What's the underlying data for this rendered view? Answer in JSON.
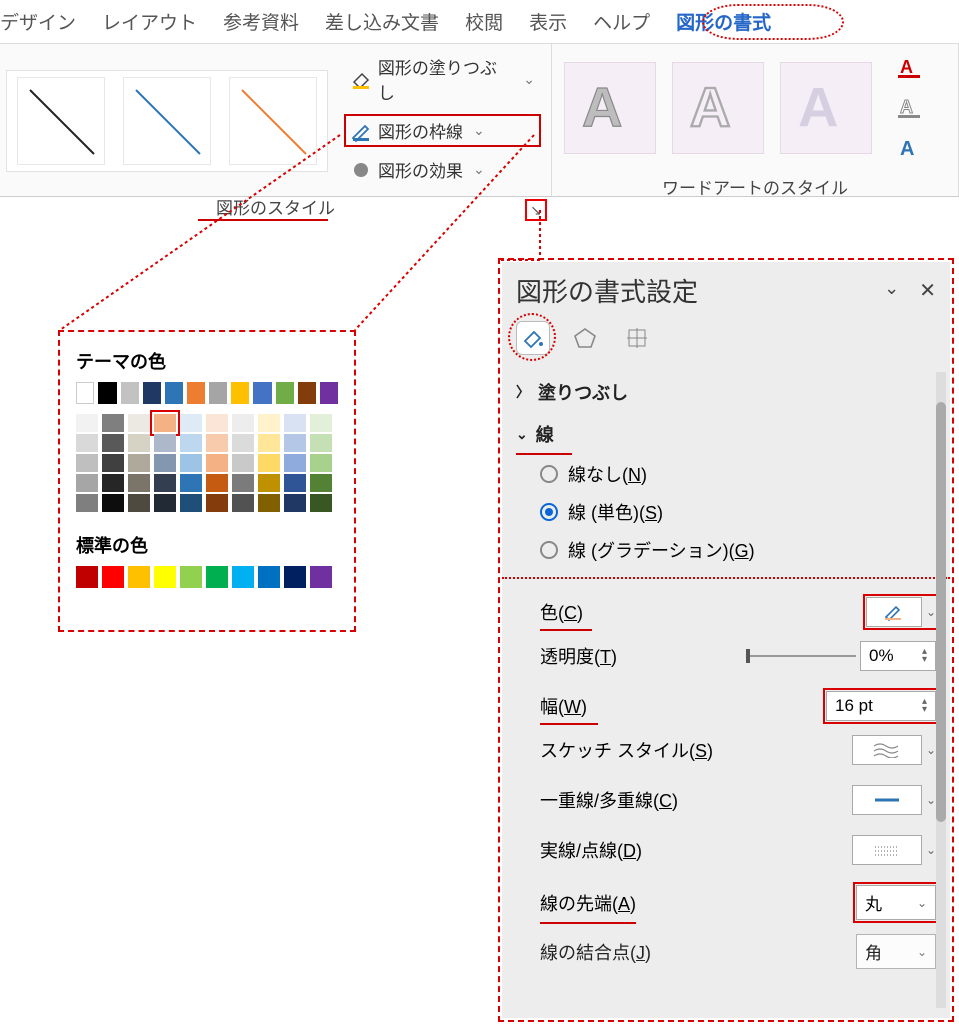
{
  "tabs": {
    "design": "デザイン",
    "layout": "レイアウト",
    "references": "参考資料",
    "mailings": "差し込み文書",
    "review": "校閲",
    "view": "表示",
    "help": "ヘルプ",
    "shape_format": "図形の書式"
  },
  "ribbon": {
    "shape_styles_label": "図形のスタイル",
    "wordart_styles_label": "ワードアートのスタイル",
    "shape_fill": "図形の塗りつぶし",
    "shape_outline": "図形の枠線",
    "shape_effects": "図形の効果",
    "wa_letter": "A"
  },
  "colorPanel": {
    "theme_title": "テーマの色",
    "standard_title": "標準の色",
    "theme_row": [
      "#ffffff",
      "#000000",
      "#c2c2c2",
      "#1f3864",
      "#2e75b6",
      "#ed7d31",
      "#a5a5a5",
      "#ffc000",
      "#4472c4",
      "#70ad47",
      "#833c0c",
      "#7030a0"
    ],
    "shade_cols": [
      [
        "#f2f2f2",
        "#d9d9d9",
        "#bfbfbf",
        "#a6a6a6",
        "#7f7f7f"
      ],
      [
        "#7f7f7f",
        "#595959",
        "#404040",
        "#262626",
        "#0d0d0d"
      ],
      [
        "#ece9e2",
        "#d6d2c4",
        "#aea99a",
        "#7a7568",
        "#4e4a40"
      ],
      [
        "#d6dce5",
        "#adb9ca",
        "#8497b0",
        "#333f50",
        "#222a35"
      ],
      [
        "#deebf7",
        "#bdd7ee",
        "#9dc3e6",
        "#2e75b6",
        "#1f4e79"
      ],
      [
        "#fbe5d6",
        "#f8cbad",
        "#f4b183",
        "#c55a11",
        "#843c0c"
      ],
      [
        "#ededed",
        "#dbdbdb",
        "#c9c9c9",
        "#7b7b7b",
        "#525252"
      ],
      [
        "#fff2cc",
        "#ffe699",
        "#ffd966",
        "#bf9000",
        "#806000"
      ],
      [
        "#d9e2f3",
        "#b4c7e7",
        "#8faadc",
        "#2f5597",
        "#203864"
      ],
      [
        "#e2f0d9",
        "#c5e0b4",
        "#a9d18e",
        "#548235",
        "#385723"
      ]
    ],
    "standard_row": [
      "#c00000",
      "#ff0000",
      "#ffc000",
      "#ffff00",
      "#92d050",
      "#00b050",
      "#00b0f0",
      "#0070c0",
      "#002060",
      "#7030a0"
    ]
  },
  "pane": {
    "title": "図形の書式設定",
    "fill_section": "塗りつぶし",
    "line_section": "線",
    "radios": {
      "none": "線なし",
      "none_k": "N",
      "solid": "線 (単色)",
      "solid_k": "S",
      "gradient": "線 (グラデーション)",
      "gradient_k": "G"
    },
    "props": {
      "color": "色",
      "color_k": "C",
      "transparency": "透明度",
      "transparency_k": "T",
      "transparency_val": "0%",
      "width": "幅",
      "width_k": "W",
      "width_val": "16 pt",
      "sketch": "スケッチ スタイル",
      "sketch_k": "S",
      "compound": "一重線/多重線",
      "compound_k": "C",
      "dash": "実線/点線",
      "dash_k": "D",
      "cap": "線の先端",
      "cap_k": "A",
      "cap_val": "丸",
      "join": "線の結合点",
      "join_k": "J",
      "join_val": "角"
    }
  }
}
